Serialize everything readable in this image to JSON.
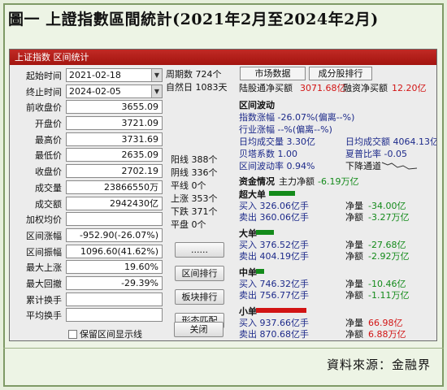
{
  "banner": {
    "title": "圖一 上證指數區間統計(2021年2月至2024年2月)"
  },
  "window": {
    "title": "上证指数 区间统计"
  },
  "form": {
    "start_label": "起始时间",
    "start_value": "2021-02-18",
    "end_label": "终止时间",
    "end_value": "2024-02-05",
    "rows": [
      {
        "label": "前收盘价",
        "value": "3655.09"
      },
      {
        "label": "开盘价",
        "value": "3721.09"
      },
      {
        "label": "最高价",
        "value": "3731.69"
      },
      {
        "label": "最低价",
        "value": "2635.09"
      },
      {
        "label": "收盘价",
        "value": "2702.19"
      },
      {
        "label": "成交量",
        "value": "23866550万"
      },
      {
        "label": "成交额",
        "value": "2942430亿"
      },
      {
        "label": "加权均价",
        "value": ""
      },
      {
        "label": "区间涨幅",
        "value": "-952.90(-26.07%)"
      },
      {
        "label": "区间振幅",
        "value": "1096.60(41.62%)"
      },
      {
        "label": "最大上涨",
        "value": "19.60%"
      },
      {
        "label": "最大回撤",
        "value": "-29.39%"
      },
      {
        "label": "累计换手",
        "value": ""
      },
      {
        "label": "平均换手",
        "value": ""
      }
    ],
    "checkbox_label": "保留区间显示线"
  },
  "stats": {
    "period_label": "周期数 724个",
    "natural_label": "自然日 1083天",
    "yang": "阳线 388个",
    "yin": "阴线 336个",
    "ping": "平线 0个",
    "up": "上涨 353个",
    "down": "下跌 371个",
    "flat": "平盘 0个"
  },
  "buttons": {
    "more": "......",
    "range_rank": "区间排行",
    "sector_rank": "板块排行",
    "pattern": "形态匹配",
    "close": "关闭"
  },
  "panel": {
    "tab_market": "市场数据",
    "tab_stock_rank": "成分股排行",
    "connect_buy_label": "陆股通净买额",
    "connect_buy_value": "3071.68亿",
    "margin_buy_label": "融资净买额",
    "margin_buy_value": "12.20亿",
    "volatility_title": "区间波动",
    "index_change": "指数涨幅 -26.07%(偏离--%)",
    "industry_change": "行业涨幅 --%(偏离--%)",
    "avg_volume": "日均成交量 3.30亿",
    "avg_turnover": "日均成交额 4064.13亿",
    "beta": "贝塔系数 1.00",
    "sharpe": "夏普比率 -0.05",
    "range_vol": "区间波动率 0.94%",
    "channel": "下降通道",
    "fund_title": "资金情况",
    "main_net_label": "主力净额",
    "main_net_value": "-6.19万亿",
    "groups": [
      {
        "name": "超大单",
        "buy": "买入 326.06亿手",
        "sell": "卖出 360.06亿手",
        "net_label": "净量",
        "net_vol": "-34.00亿",
        "amt_label": "净额",
        "net_amt": "-3.27万亿"
      },
      {
        "name": "大单",
        "buy": "买入 376.52亿手",
        "sell": "卖出 404.19亿手",
        "net_label": "净量",
        "net_vol": "-27.68亿",
        "amt_label": "净额",
        "net_amt": "-2.92万亿"
      },
      {
        "name": "中单",
        "buy": "买入 746.32亿手",
        "sell": "卖出 756.77亿手",
        "net_label": "净量",
        "net_vol": "-10.46亿",
        "amt_label": "净额",
        "net_amt": "-1.11万亿"
      },
      {
        "name": "小单",
        "buy": "买入 937.66亿手",
        "sell": "卖出 870.68亿手",
        "net_label": "净量",
        "net_vol": "66.98亿",
        "amt_label": "净额",
        "net_amt": "6.88万亿"
      }
    ]
  },
  "source": "資料來源：金融界",
  "colors": {
    "title_bar": "#b01d18",
    "up": "#d21414",
    "down": "#138a1a",
    "text_blue": "#1d2a8a"
  }
}
